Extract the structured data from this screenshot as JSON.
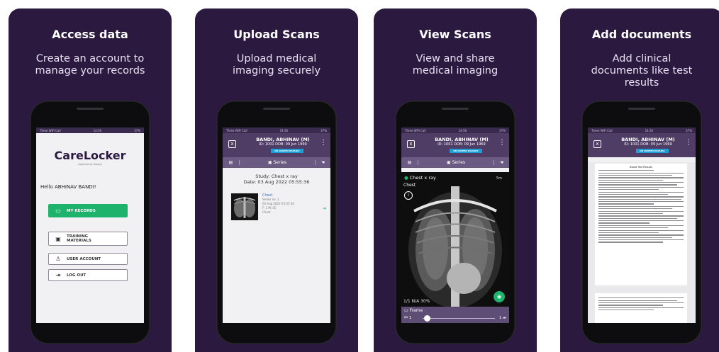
{
  "cards": [
    {
      "title": "Access data",
      "subtitle": "Create an account to\nmanage your records"
    },
    {
      "title": "Upload Scans",
      "subtitle": "Upload medical\nimaging securely"
    },
    {
      "title": "View Scans",
      "subtitle": "View and share\nmedical imaging"
    },
    {
      "title": "Add documents",
      "subtitle": "Add clinical\ndocuments like test\nresults"
    }
  ],
  "status": {
    "carrier": "Three WiFi Call",
    "time": "14:56",
    "battery": "37%"
  },
  "login": {
    "logo": "CareLocker",
    "logo_sub": "powered by Elaaya",
    "greeting": "Hello ABHINAV BANDI!",
    "buttons": {
      "records": "MY RECORDS",
      "training_line1": "TRAINING",
      "training_line2": "MATERIALS",
      "account": "USER ACCOUNT",
      "logout": "LOG OUT"
    }
  },
  "patient": {
    "name": "BANDI, ABHINAV (M)",
    "ids": "ID: 1001  DOB: 09 Jun 1969",
    "doctor": "DR NAVEEN KAPADIA"
  },
  "tabs": {
    "series": "Series"
  },
  "study": {
    "line1": "Study: Chest x ray",
    "line2": "Date: 03 Aug 2022 05:55:36",
    "item_title": "Chest",
    "item_series": "Series no. 1",
    "item_date": "03 Aug 2022 05:55:36",
    "item_frames": "F: 1  M: SC",
    "item_body": "Chest"
  },
  "viewer": {
    "label": "Chest x ray",
    "sub": "Chest",
    "corner": "5m",
    "bottom": "1/1   N/A   30%",
    "frame_label": "Frame",
    "frame_start": "1",
    "frame_end": "1"
  },
  "document": {
    "heading": "Blood Test Results"
  },
  "colors": {
    "card_bg": "#2b1940",
    "header": "#4f3d66",
    "accent_green": "#1eb36c",
    "accent_blue": "#1d9fd6"
  },
  "icons": {
    "records": "folder-icon",
    "training": "book-icon",
    "account": "user-icon",
    "logout": "logout-icon"
  }
}
